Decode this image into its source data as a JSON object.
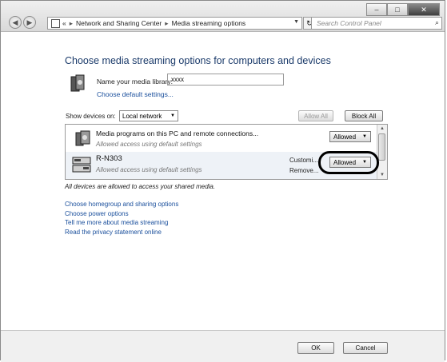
{
  "window": {
    "controls": {
      "minimize": "–",
      "maximize": "□",
      "close": "✕"
    }
  },
  "address_bar": {
    "root": "«",
    "crumbs": [
      "Network and Sharing Center",
      "Media streaming options"
    ],
    "separator": "▸",
    "search_placeholder": "Search Control Panel"
  },
  "page": {
    "title": "Choose media streaming options for computers and devices",
    "library_label": "Name your media library:",
    "library_value": "xxxx",
    "choose_defaults_link": "Choose default settings...",
    "show_devices_label": "Show devices on:",
    "show_devices_value": "Local network",
    "allow_all_button": "Allow All",
    "block_all_button": "Block All",
    "devices": [
      {
        "name": "Media programs on this PC and remote connections...",
        "subtitle": "Allowed access using default settings",
        "status": "Allowed"
      },
      {
        "name": "R-N303",
        "subtitle": "Allowed access using default settings",
        "customize_link": "Customi...",
        "remove_link": "Remove...",
        "status": "Allowed"
      }
    ],
    "note": "All devices are allowed to access your shared media.",
    "links": [
      "Choose homegroup and sharing options",
      "Choose power options",
      "Tell me more about media streaming",
      "Read the privacy statement online"
    ]
  },
  "footer": {
    "ok_button": "OK",
    "cancel_button": "Cancel"
  }
}
